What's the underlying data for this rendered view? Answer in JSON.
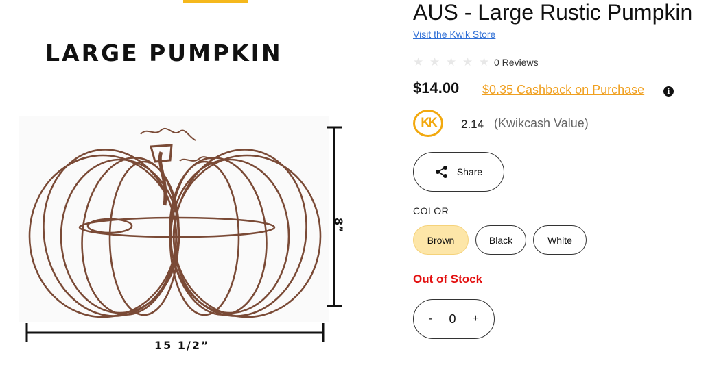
{
  "image": {
    "title": "LARGE PUMPKIN",
    "width_label": "15 1/2”",
    "height_label": "8”"
  },
  "product": {
    "title": "AUS - Large Rustic Pumpkin",
    "store_link": "Visit the Kwik Store",
    "rating_stars": 0,
    "reviews": "0 Reviews",
    "price": "$14.00",
    "cashback": "$0.35 Cashback on Purchase",
    "info_icon": "info-icon",
    "kwikcash_logo": "KK",
    "kwikcash_value": "2.14",
    "kwikcash_label": "(Kwikcash Value)",
    "share_label": "Share",
    "color_label": "COLOR",
    "colors": [
      "Brown",
      "Black",
      "White"
    ],
    "selected_color": "Brown",
    "stock_status": "Out of Stock",
    "quantity": {
      "minus": "-",
      "value": "0",
      "plus": "+"
    }
  },
  "colors": {
    "accent": "#f5b81c",
    "link": "#2f6fd6",
    "cashback": "#f0a020",
    "selected_bg": "#fde6a8",
    "out_of_stock": "#e31010"
  }
}
